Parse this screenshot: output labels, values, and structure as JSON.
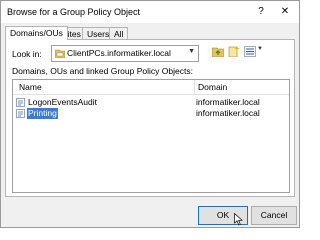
{
  "window": {
    "title": "Browse for a Group Policy Object",
    "help_label": "?",
    "close_label": "✕"
  },
  "tabs": [
    {
      "label": "Domains/OUs",
      "active": true
    },
    {
      "label": "Sites",
      "active": false
    },
    {
      "label": "Users",
      "active": false
    },
    {
      "label": "All",
      "active": false
    }
  ],
  "look_in": {
    "label": "Look in:",
    "value": "ClientPCs.informatiker.local",
    "icon": "ou-folder-icon"
  },
  "toolbar": {
    "icons": [
      "up-folder-icon",
      "new-gpo-icon",
      "view-list-icon"
    ],
    "dropdown_glyph": "▼"
  },
  "list": {
    "caption": "Domains, OUs and linked Group Policy Objects:",
    "columns": [
      "Name",
      "Domain"
    ],
    "rows": [
      {
        "name": "LogonEventsAudit",
        "domain": "informatiker.local",
        "selected": false,
        "icon": "gpo-icon"
      },
      {
        "name": "Printing",
        "domain": "informatiker.local",
        "selected": true,
        "icon": "gpo-icon"
      }
    ]
  },
  "buttons": {
    "ok_label": "OK",
    "cancel_label": "Cancel"
  },
  "colors": {
    "selection": "#3a7bd5",
    "default_button_border": "#0078d7",
    "dialog_bg": "#f0f0f0"
  }
}
